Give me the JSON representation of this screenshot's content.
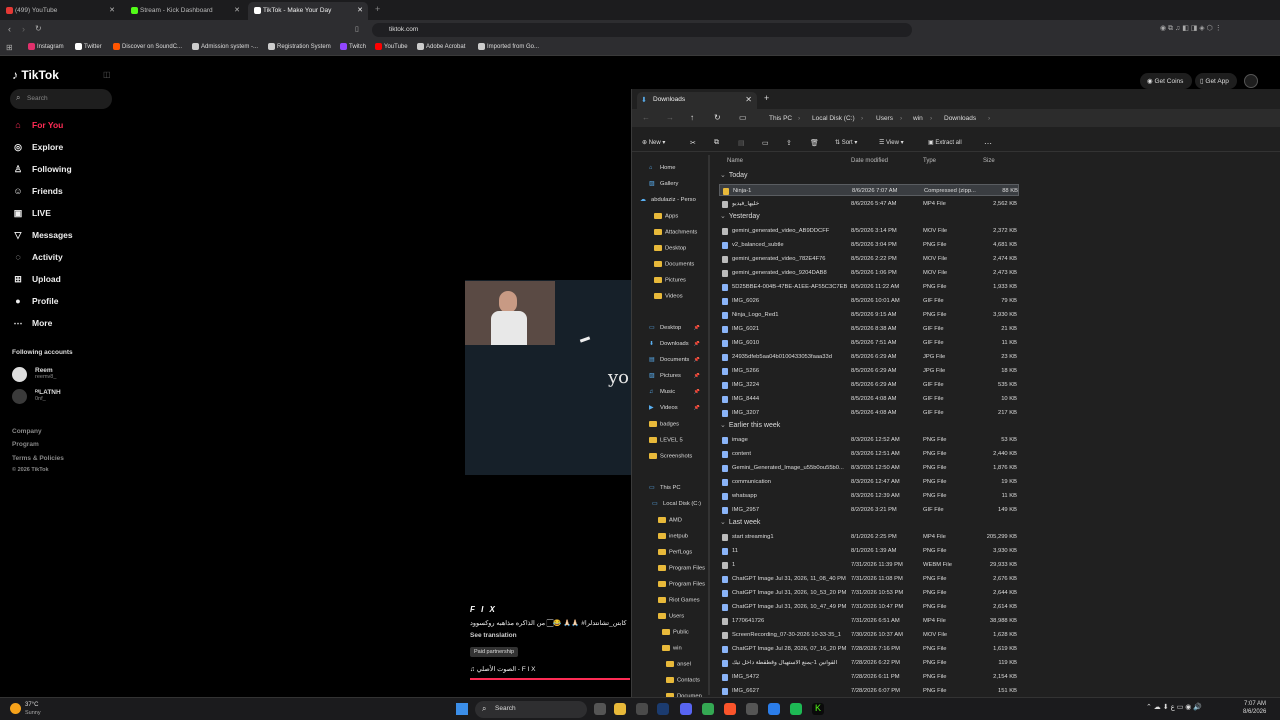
{
  "browser": {
    "tabs": [
      {
        "label": "(499) YouTube",
        "color": "#e53935"
      },
      {
        "label": "Stream - Kick Dashboard",
        "color": "#53fc18"
      },
      {
        "label": "TikTok - Make Your Day",
        "color": "#ffffff",
        "active": true
      }
    ],
    "url": "tiktok.com",
    "bookmarks": [
      {
        "label": "Instagram",
        "color": "#e1306c"
      },
      {
        "label": "Twitter",
        "color": "#ffffff"
      },
      {
        "label": "Discover on SoundC...",
        "color": "#ff5500"
      },
      {
        "label": "Admission system -...",
        "color": "#cccccc"
      },
      {
        "label": "Registration System",
        "color": "#cccccc"
      },
      {
        "label": "Twitch",
        "color": "#9146ff"
      },
      {
        "label": "YouTube",
        "color": "#ff0000"
      },
      {
        "label": "Adobe Acrobat",
        "color": "#cccccc"
      },
      {
        "label": "Imported from Go...",
        "color": "#cccccc"
      }
    ]
  },
  "tiktok": {
    "logo": "TikTok",
    "search_placeholder": "Search",
    "nav": [
      {
        "label": "For You",
        "icon": "home-icon",
        "glyph": "⌂",
        "active": true
      },
      {
        "label": "Explore",
        "icon": "compass-icon",
        "glyph": "◎"
      },
      {
        "label": "Following",
        "icon": "following-icon",
        "glyph": "♙"
      },
      {
        "label": "Friends",
        "icon": "friends-icon",
        "glyph": "☺"
      },
      {
        "label": "LIVE",
        "icon": "live-icon",
        "glyph": "▣"
      },
      {
        "label": "Messages",
        "icon": "messages-icon",
        "glyph": "▽"
      },
      {
        "label": "Activity",
        "icon": "activity-icon",
        "glyph": "◌"
      },
      {
        "label": "Upload",
        "icon": "upload-icon",
        "glyph": "⊞"
      },
      {
        "label": "Profile",
        "icon": "profile-icon",
        "glyph": "●"
      },
      {
        "label": "More",
        "icon": "more-icon",
        "glyph": "⋯"
      }
    ],
    "following_title": "Following accounts",
    "following": [
      {
        "name": "Reem",
        "handle": "reemv8_"
      },
      {
        "name": "ᴿᴵLATNH",
        "handle": "0nf_"
      }
    ],
    "footer": [
      "Company",
      "Program",
      "Terms & Policies",
      "© 2026 TikTok"
    ],
    "get_coins": "Get Coins",
    "get_app": "Get App",
    "video_overlay_text": "yo",
    "caption": {
      "title": "F I X",
      "text": "كابتن_تشانتدلرا# 🙏🏻🙏🏻 😂🏻 من الذاكره مذاهبه روكسوود",
      "see_translation": "See translation",
      "badge": "Paid partnership",
      "sound": "♫  الصوت الأصلي - F I X"
    }
  },
  "explorer": {
    "tab_title": "Downloads",
    "breadcrumb": [
      "This PC",
      "Local Disk (C:)",
      "Users",
      "win",
      "Downloads"
    ],
    "commands": {
      "new": "New",
      "sort": "Sort",
      "view": "View",
      "extract": "Extract all"
    },
    "columns": [
      "Name",
      "Date modified",
      "Type",
      "Size"
    ],
    "tree": [
      {
        "label": "Home"
      },
      {
        "label": "Gallery"
      },
      {
        "label": "abdulaziz - Perso"
      },
      {
        "label": "Apps"
      },
      {
        "label": "Attachments"
      },
      {
        "label": "Desktop"
      },
      {
        "label": "Documents"
      },
      {
        "label": "Pictures"
      },
      {
        "label": "Videos"
      },
      {
        "label": "Desktop"
      },
      {
        "label": "Downloads"
      },
      {
        "label": "Documents"
      },
      {
        "label": "Pictures"
      },
      {
        "label": "Music"
      },
      {
        "label": "Videos"
      },
      {
        "label": "badges"
      },
      {
        "label": "LEVEL 5"
      },
      {
        "label": "Screenshots"
      },
      {
        "label": "This PC"
      },
      {
        "label": "Local Disk (C:)"
      },
      {
        "label": "AMD"
      },
      {
        "label": "inetpub"
      },
      {
        "label": "PerfLogs"
      },
      {
        "label": "Program Files"
      },
      {
        "label": "Program Files"
      },
      {
        "label": "Riot Games"
      },
      {
        "label": "Users"
      },
      {
        "label": "Public"
      },
      {
        "label": "win"
      },
      {
        "label": "ansel"
      },
      {
        "label": "Contacts"
      },
      {
        "label": "Documen"
      }
    ],
    "groups": [
      {
        "label": "Today",
        "files": [
          [
            "Ninja-1",
            "8/6/2026 7:07 AM",
            "Compressed (zipp...",
            "88 KB"
          ],
          [
            "خليها_فيديو",
            "8/6/2026 5:47 AM",
            "MP4 File",
            "2,562 KB"
          ]
        ]
      },
      {
        "label": "Yesterday",
        "files": [
          [
            "gemini_generated_video_AB9DDCFF",
            "8/5/2026 3:14 PM",
            "MOV File",
            "2,372 KB"
          ],
          [
            "v2_balanced_subtle",
            "8/5/2026 3:04 PM",
            "PNG File",
            "4,681 KB"
          ],
          [
            "gemini_generated_video_782E4F76",
            "8/5/2026 2:22 PM",
            "MOV File",
            "2,474 KB"
          ],
          [
            "gemini_generated_video_9204DAB8",
            "8/5/2026 1:06 PM",
            "MOV File",
            "2,473 KB"
          ],
          [
            "5D25BBE4-004B-47BE-A1EE-AF55C3C7EB...",
            "8/5/2026 11:22 AM",
            "PNG File",
            "1,933 KB"
          ],
          [
            "IMG_6026",
            "8/5/2026 10:01 AM",
            "GIF File",
            "79 KB"
          ],
          [
            "Ninja_Logo_Red1",
            "8/5/2026 9:15 AM",
            "PNG File",
            "3,930 KB"
          ],
          [
            "IMG_6021",
            "8/5/2026 8:38 AM",
            "GIF File",
            "21 KB"
          ],
          [
            "IMG_6010",
            "8/5/2026 7:51 AM",
            "GIF File",
            "11 KB"
          ],
          [
            "24935dfeb5aa04b0100433053faaa33d",
            "8/5/2026 6:29 AM",
            "JPG File",
            "23 KB"
          ],
          [
            "IMG_5266",
            "8/5/2026 6:29 AM",
            "JPG File",
            "18 KB"
          ],
          [
            "IMG_3224",
            "8/5/2026 6:29 AM",
            "GIF File",
            "535 KB"
          ],
          [
            "IMG_8444",
            "8/5/2026 4:08 AM",
            "GIF File",
            "10 KB"
          ],
          [
            "IMG_3207",
            "8/5/2026 4:08 AM",
            "GIF File",
            "217 KB"
          ]
        ]
      },
      {
        "label": "Earlier this week",
        "files": [
          [
            "image",
            "8/3/2026 12:52 AM",
            "PNG File",
            "53 KB"
          ],
          [
            "content",
            "8/3/2026 12:51 AM",
            "PNG File",
            "2,440 KB"
          ],
          [
            "Gemini_Generated_Image_u55b0ou55b0...",
            "8/3/2026 12:50 AM",
            "PNG File",
            "1,876 KB"
          ],
          [
            "communication",
            "8/3/2026 12:47 AM",
            "PNG File",
            "19 KB"
          ],
          [
            "whatsapp",
            "8/3/2026 12:39 AM",
            "PNG File",
            "11 KB"
          ],
          [
            "IMG_2957",
            "8/2/2026 3:21 PM",
            "GIF File",
            "149 KB"
          ]
        ]
      },
      {
        "label": "Last week",
        "files": [
          [
            "start streaming1",
            "8/1/2026 2:25 PM",
            "MP4 File",
            "205,299 KB"
          ],
          [
            "11",
            "8/1/2026 1:39 AM",
            "PNG File",
            "3,930 KB"
          ],
          [
            "1",
            "7/31/2026 11:39 PM",
            "WEBM File",
            "29,933 KB"
          ],
          [
            "ChatGPT Image Jul 31, 2026, 11_08_40 PM",
            "7/31/2026 11:08 PM",
            "PNG File",
            "2,676 KB"
          ],
          [
            "ChatGPT Image Jul 31, 2026, 10_53_20 PM",
            "7/31/2026 10:53 PM",
            "PNG File",
            "2,644 KB"
          ],
          [
            "ChatGPT Image Jul 31, 2026, 10_47_49 PM",
            "7/31/2026 10:47 PM",
            "PNG File",
            "2,614 KB"
          ],
          [
            "1770641726",
            "7/31/2026 6:51 AM",
            "MP4 File",
            "38,988 KB"
          ],
          [
            "ScreenRecording_07-30-2026 10-33-35_1",
            "7/30/2026 10:37 AM",
            "MOV File",
            "1,628 KB"
          ],
          [
            "ChatGPT Image Jul 28, 2026, 07_16_20 PM",
            "7/28/2026 7:16 PM",
            "PNG File",
            "1,619 KB"
          ],
          [
            "القوانين 1-يمنع الاستهبال وقطقطة داخل تيك",
            "7/28/2026 6:22 PM",
            "PNG File",
            "119 KB"
          ],
          [
            "IMG_5472",
            "7/28/2026 6:11 PM",
            "PNG File",
            "2,154 KB"
          ],
          [
            "IMG_6627",
            "7/28/2026 6:07 PM",
            "PNG File",
            "151 KB"
          ]
        ]
      }
    ]
  },
  "taskbar": {
    "weather_temp": "37°C",
    "weather_desc": "Sunny",
    "search": "Search",
    "time": "7:07 AM",
    "date": "8/6/2026"
  }
}
